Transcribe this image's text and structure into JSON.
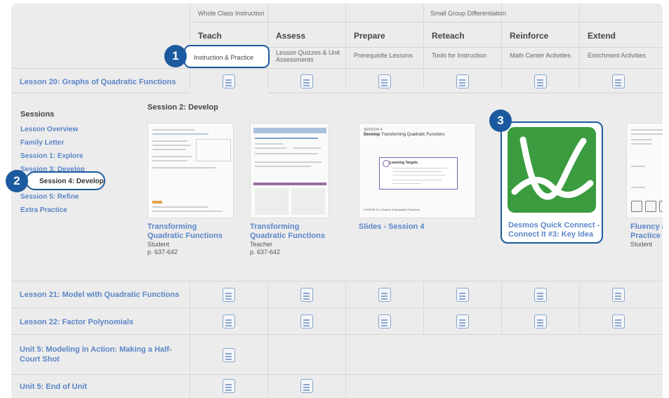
{
  "groups": {
    "whole_class": "Whole Class Instruction",
    "small_group": "Small Group Differentiation"
  },
  "columns": [
    {
      "label": "Teach",
      "sub": "Instruction & Practice"
    },
    {
      "label": "Assess",
      "sub": "Lesson Quizzes & Unit Assessments"
    },
    {
      "label": "Prepare",
      "sub": "Prerequisite Lessons"
    },
    {
      "label": "Reteach",
      "sub": "Tools for Instruction"
    },
    {
      "label": "Reinforce",
      "sub": "Math Center Activities"
    },
    {
      "label": "Extend",
      "sub": "Enrichment Activities"
    }
  ],
  "lessons": [
    "Lesson 20: Graphs of Quadratic Functions",
    "Lesson 21: Model with Quadratic Functions",
    "Lesson 22: Factor Polynomials",
    "Unit 5: Modeling in Action: Making a Half-Court Shot",
    "Unit 5: End of Unit"
  ],
  "sessions": {
    "title": "Sessions",
    "items": [
      "Lesson Overview",
      "Family Letter",
      "Session 1: Explore",
      "Session 3: Develop",
      "Session 4: Develop",
      "Session 5: Refine",
      "Extra Practice"
    ]
  },
  "session_title": "Session 2: Develop",
  "resources": [
    {
      "title1": "Transforming",
      "title2": "Quadratic Functions",
      "sub1": "Student",
      "sub2": "p. 637-642"
    },
    {
      "title1": "Transforming",
      "title2": "Quadratic Functions",
      "sub1": "Teacher",
      "sub2": "p. 637-642"
    },
    {
      "title1": "Slides - Session 4"
    },
    {
      "title1": "Desmos Quick Connect -",
      "title2": "Connect It #3: Key Idea"
    },
    {
      "title1": "Fluency ar",
      "title2": "Practice",
      "sub1": "Student"
    }
  ],
  "slide": {
    "session": "SESSION 4",
    "heading_bold": "Develop",
    "heading": "Transforming Quadratic Functions",
    "box_title": "Learning Targets",
    "footer": "LESSON 20 • Graphs of Quadratic Functions"
  },
  "callouts": [
    "1",
    "2",
    "3"
  ],
  "colors": {
    "accent": "#1c5a9f",
    "link": "#5b86c8",
    "desmos": "#3a9c3e"
  }
}
